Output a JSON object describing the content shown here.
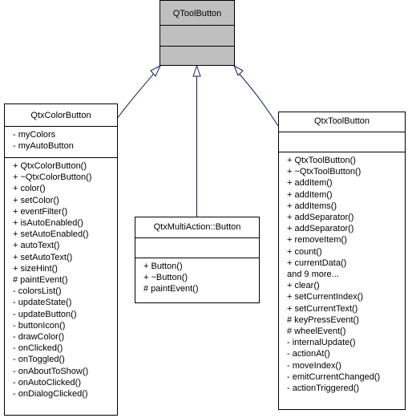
{
  "diagram": {
    "type": "UML class inheritance diagram",
    "edge_color": "#191970",
    "base_fill": "#bfbfbf",
    "classes": {
      "base": {
        "name": "QToolButton",
        "attributes": [],
        "methods": []
      },
      "color_button": {
        "name": "QtxColorButton",
        "attributes": [
          "- myColors",
          "- myAutoButton"
        ],
        "methods": [
          "+ QtxColorButton()",
          "+ ~QtxColorButton()",
          "+ color()",
          "+ setColor()",
          "+ eventFilter()",
          "+ isAutoEnabled()",
          "+ setAutoEnabled()",
          "+ autoText()",
          "+ setAutoText()",
          "+ sizeHint()",
          "# paintEvent()",
          "- colorsList()",
          "- updateState()",
          "- updateButton()",
          "- buttonIcon()",
          "- drawColor()",
          "- onClicked()",
          "- onToggled()",
          "- onAboutToShow()",
          "- onAutoClicked()",
          "- onDialogClicked()"
        ]
      },
      "multi_action_button": {
        "name": "QtxMultiAction::Button",
        "attributes": [],
        "methods": [
          "+ Button()",
          "+ ~Button()",
          "# paintEvent()"
        ]
      },
      "tool_button": {
        "name": "QtxToolButton",
        "attributes": [],
        "methods": [
          "+ QtxToolButton()",
          "+ ~QtxToolButton()",
          "+ addItem()",
          "+ addItem()",
          "+ addItems()",
          "+ addSeparator()",
          "+ addSeparator()",
          "+ removeItem()",
          "+ count()",
          "+ currentData()",
          "and 9 more...",
          "+ clear()",
          "+ setCurrentIndex()",
          "+ setCurrentText()",
          "# keyPressEvent()",
          "# wheelEvent()",
          "- internalUpdate()",
          "- actionAt()",
          "- moveIndex()",
          "- emitCurrentChanged()",
          "- actionTriggered()"
        ]
      }
    },
    "inheritance": [
      {
        "from": "QtxColorButton",
        "to": "QToolButton"
      },
      {
        "from": "QtxMultiAction::Button",
        "to": "QToolButton"
      },
      {
        "from": "QtxToolButton",
        "to": "QToolButton"
      }
    ]
  }
}
